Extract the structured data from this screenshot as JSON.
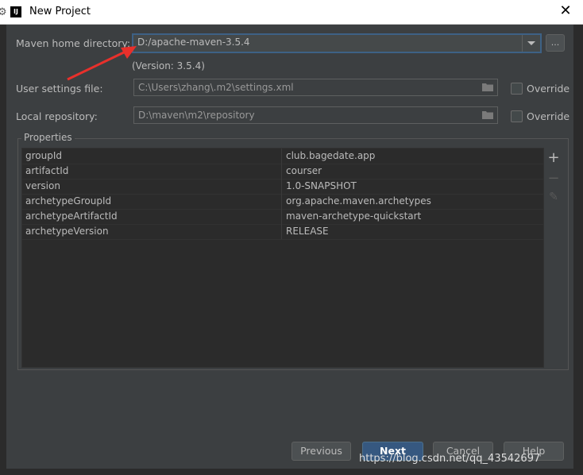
{
  "window": {
    "title": "New Project",
    "app_icon_text": "IJ"
  },
  "maven_home": {
    "label": "Maven home directory:",
    "value": "D:/apache-maven-3.5.4",
    "version": "(Version: 3.5.4)",
    "browse_label": "..."
  },
  "user_settings": {
    "label": "User settings file:",
    "value": "C:\\Users\\zhang\\.m2\\settings.xml",
    "override_label": "Override"
  },
  "local_repo": {
    "label": "Local repository:",
    "value": "D:\\maven\\m2\\repository",
    "override_label": "Override"
  },
  "properties": {
    "title": "Properties",
    "rows": [
      {
        "key": "groupId",
        "value": "club.bagedate.app"
      },
      {
        "key": "artifactId",
        "value": "courser"
      },
      {
        "key": "version",
        "value": "1.0-SNAPSHOT"
      },
      {
        "key": "archetypeGroupId",
        "value": "org.apache.maven.archetypes"
      },
      {
        "key": "archetypeArtifactId",
        "value": "maven-archetype-quickstart"
      },
      {
        "key": "archetypeVersion",
        "value": "RELEASE"
      }
    ]
  },
  "buttons": {
    "previous": "Previous",
    "next": "Next",
    "cancel": "Cancel",
    "help": "Help"
  },
  "watermark": "https://blog.csdn.net/qq_43542697",
  "colors": {
    "accent": "#365880",
    "annotation_arrow": "#e8302b"
  }
}
